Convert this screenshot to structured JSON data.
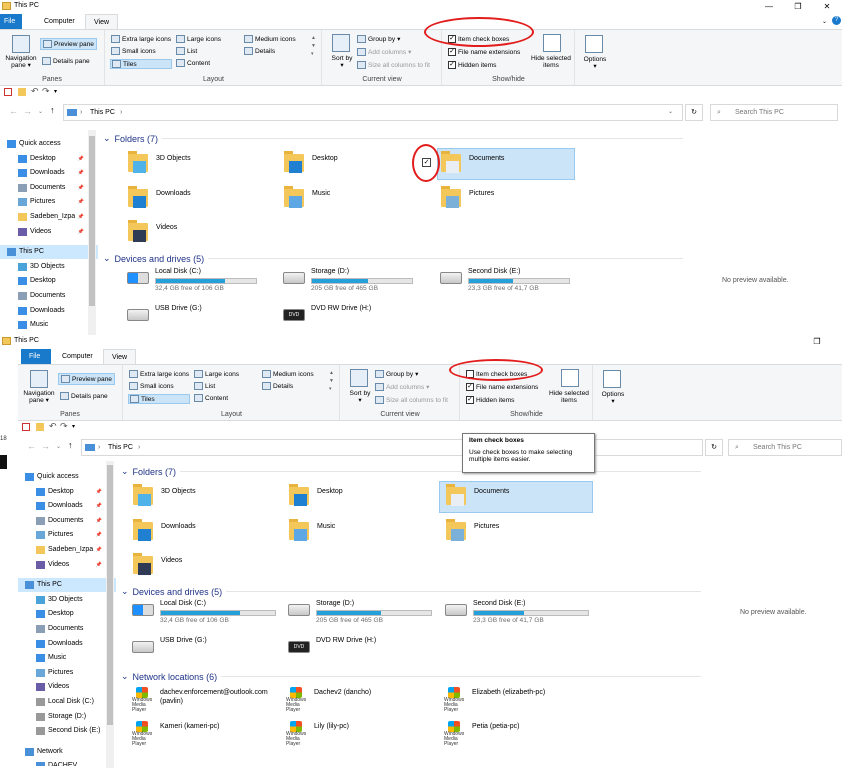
{
  "top": {
    "title": "This PC",
    "tabs": [
      "File",
      "Computer",
      "View"
    ],
    "ribbon": {
      "nav_pane": "Navigation pane",
      "preview_pane": "Preview pane",
      "details_pane": "Details pane",
      "panes_label": "Panes",
      "layout_items": [
        "Extra large icons",
        "Large icons",
        "Medium icons",
        "Small icons",
        "List",
        "Details",
        "Tiles",
        "Content"
      ],
      "layout_label": "Layout",
      "sort_by": "Sort by",
      "group_by": "Group by",
      "add_columns": "Add columns",
      "size_columns": "Size all columns to fit",
      "current_view_label": "Current view",
      "item_check_boxes": "Item check boxes",
      "file_name_extensions": "File name extensions",
      "hidden_items": "Hidden items",
      "hide_selected": "Hide selected items",
      "show_hide_label": "Show/hide",
      "options": "Options"
    },
    "address": {
      "path": "This PC",
      "search_placeholder": "Search This PC"
    },
    "nav": [
      {
        "label": "Quick access",
        "pin": false
      },
      {
        "label": "Desktop",
        "pin": true
      },
      {
        "label": "Downloads",
        "pin": true
      },
      {
        "label": "Documents",
        "pin": true
      },
      {
        "label": "Pictures",
        "pin": true
      },
      {
        "label": "Sadeben_Izpa",
        "pin": true
      },
      {
        "label": "Videos",
        "pin": true
      },
      {
        "label": "This PC",
        "pin": false
      },
      {
        "label": "3D Objects",
        "pin": false
      },
      {
        "label": "Desktop",
        "pin": false
      },
      {
        "label": "Documents",
        "pin": false
      },
      {
        "label": "Downloads",
        "pin": false
      },
      {
        "label": "Music",
        "pin": false
      }
    ],
    "folders_header": "Folders (7)",
    "folders": [
      "3D Objects",
      "Desktop",
      "Documents",
      "Downloads",
      "Music",
      "Pictures",
      "Videos"
    ],
    "devices_header": "Devices and drives (5)",
    "drives": [
      {
        "name": "Local Disk (C:)",
        "free": "32,4 GB free of 106 GB",
        "fill": 0.69
      },
      {
        "name": "Storage (D:)",
        "free": "205 GB free of 465 GB",
        "fill": 0.56
      },
      {
        "name": "Second Disk (E:)",
        "free": "23,3 GB free of 41,7 GB",
        "fill": 0.44
      },
      {
        "name": "USB Drive (G:)",
        "free": ""
      },
      {
        "name": "DVD RW Drive (H:)",
        "free": ""
      }
    ],
    "preview_text": "No preview available."
  },
  "bottom": {
    "title": "This PC",
    "tabs": [
      "File",
      "Computer",
      "View"
    ],
    "nav": [
      {
        "label": "Quick access",
        "pin": false
      },
      {
        "label": "Desktop",
        "pin": true
      },
      {
        "label": "Downloads",
        "pin": true
      },
      {
        "label": "Documents",
        "pin": true
      },
      {
        "label": "Pictures",
        "pin": true
      },
      {
        "label": "Sadeben_Izpa",
        "pin": true
      },
      {
        "label": "Videos",
        "pin": true
      },
      {
        "label": "This PC",
        "pin": false
      },
      {
        "label": "3D Objects",
        "pin": false
      },
      {
        "label": "Desktop",
        "pin": false
      },
      {
        "label": "Documents",
        "pin": false
      },
      {
        "label": "Downloads",
        "pin": false
      },
      {
        "label": "Music",
        "pin": false
      },
      {
        "label": "Pictures",
        "pin": false
      },
      {
        "label": "Videos",
        "pin": false
      },
      {
        "label": "Local Disk (C:)",
        "pin": false
      },
      {
        "label": "Storage (D:)",
        "pin": false
      },
      {
        "label": "Second Disk (E:)",
        "pin": false
      },
      {
        "label": "Network",
        "pin": false
      },
      {
        "label": "DACHEV",
        "pin": false
      }
    ],
    "tooltip_title": "Item check boxes",
    "tooltip_body": "Use check boxes to make selecting multiple items easier.",
    "network_header": "Network locations (6)",
    "network": [
      "dachev.enforcement@outlook.com (pavlin)",
      "Dachev2 (dancho)",
      "Elizabeth (elizabeth-pc)",
      "Kameri (kameri-pc)",
      "Lily (lily-pc)",
      "Petia (petia-pc)"
    ],
    "windows_media_player": "Windows Media Player",
    "left_number": "18"
  },
  "colors": {
    "accent": "#1979ca",
    "selection": "#cce8ff",
    "drive_bar": "#26a0da",
    "annotation": "#e21b1b",
    "header": "#1e3287"
  }
}
